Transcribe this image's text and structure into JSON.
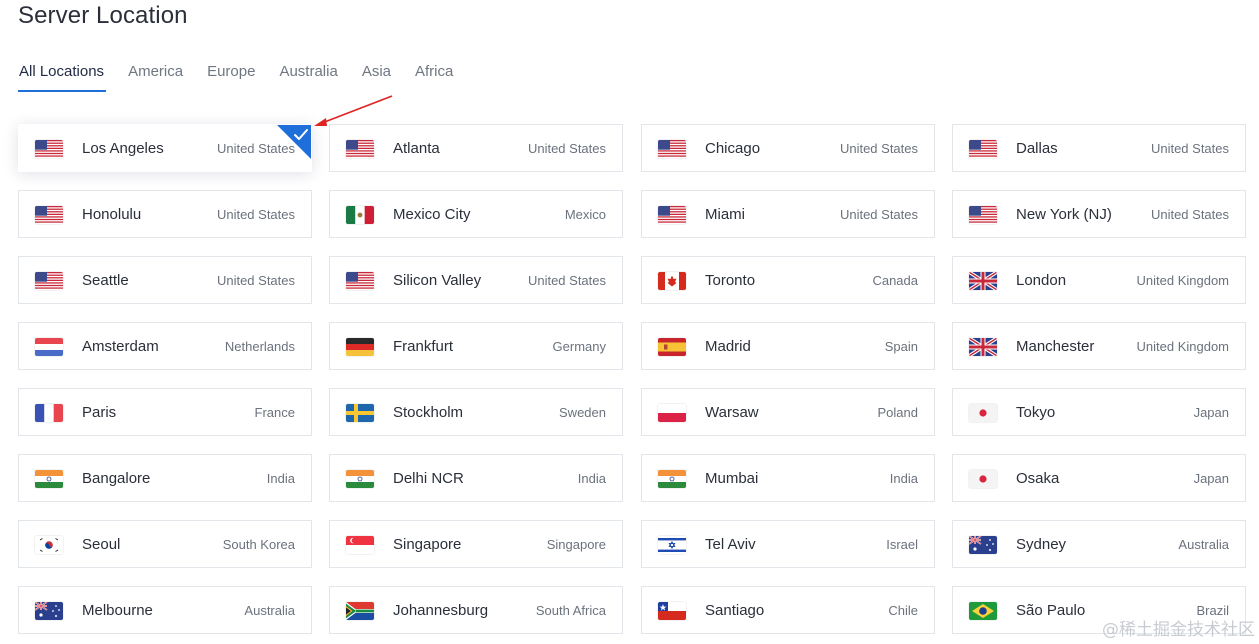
{
  "page_title": "Server Location",
  "tabs": [
    {
      "label": "All Locations",
      "active": true
    },
    {
      "label": "America",
      "active": false
    },
    {
      "label": "Europe",
      "active": false
    },
    {
      "label": "Australia",
      "active": false
    },
    {
      "label": "Asia",
      "active": false
    },
    {
      "label": "Africa",
      "active": false
    }
  ],
  "selected_location": "Los Angeles",
  "locations": [
    {
      "city": "Los Angeles",
      "country": "United States",
      "flag": "us-flag-icon",
      "selected": true
    },
    {
      "city": "Atlanta",
      "country": "United States",
      "flag": "us-flag-icon"
    },
    {
      "city": "Chicago",
      "country": "United States",
      "flag": "us-flag-icon"
    },
    {
      "city": "Dallas",
      "country": "United States",
      "flag": "us-flag-icon"
    },
    {
      "city": "Honolulu",
      "country": "United States",
      "flag": "us-flag-icon"
    },
    {
      "city": "Mexico City",
      "country": "Mexico",
      "flag": "mx-flag-icon"
    },
    {
      "city": "Miami",
      "country": "United States",
      "flag": "us-flag-icon"
    },
    {
      "city": "New York (NJ)",
      "country": "United States",
      "flag": "us-flag-icon"
    },
    {
      "city": "Seattle",
      "country": "United States",
      "flag": "us-flag-icon"
    },
    {
      "city": "Silicon Valley",
      "country": "United States",
      "flag": "us-flag-icon"
    },
    {
      "city": "Toronto",
      "country": "Canada",
      "flag": "ca-flag-icon"
    },
    {
      "city": "London",
      "country": "United Kingdom",
      "flag": "gb-flag-icon"
    },
    {
      "city": "Amsterdam",
      "country": "Netherlands",
      "flag": "nl-flag-icon"
    },
    {
      "city": "Frankfurt",
      "country": "Germany",
      "flag": "de-flag-icon"
    },
    {
      "city": "Madrid",
      "country": "Spain",
      "flag": "es-flag-icon"
    },
    {
      "city": "Manchester",
      "country": "United Kingdom",
      "flag": "gb-flag-icon"
    },
    {
      "city": "Paris",
      "country": "France",
      "flag": "fr-flag-icon"
    },
    {
      "city": "Stockholm",
      "country": "Sweden",
      "flag": "se-flag-icon"
    },
    {
      "city": "Warsaw",
      "country": "Poland",
      "flag": "pl-flag-icon"
    },
    {
      "city": "Tokyo",
      "country": "Japan",
      "flag": "jp-flag-icon"
    },
    {
      "city": "Bangalore",
      "country": "India",
      "flag": "in-flag-icon"
    },
    {
      "city": "Delhi NCR",
      "country": "India",
      "flag": "in-flag-icon"
    },
    {
      "city": "Mumbai",
      "country": "India",
      "flag": "in-flag-icon"
    },
    {
      "city": "Osaka",
      "country": "Japan",
      "flag": "jp-flag-icon"
    },
    {
      "city": "Seoul",
      "country": "South Korea",
      "flag": "kr-flag-icon"
    },
    {
      "city": "Singapore",
      "country": "Singapore",
      "flag": "sg-flag-icon"
    },
    {
      "city": "Tel Aviv",
      "country": "Israel",
      "flag": "il-flag-icon"
    },
    {
      "city": "Sydney",
      "country": "Australia",
      "flag": "au-flag-icon"
    },
    {
      "city": "Melbourne",
      "country": "Australia",
      "flag": "au-flag-icon"
    },
    {
      "city": "Johannesburg",
      "country": "South Africa",
      "flag": "za-flag-icon"
    },
    {
      "city": "Santiago",
      "country": "Chile",
      "flag": "cl-flag-icon"
    },
    {
      "city": "São Paulo",
      "country": "Brazil",
      "flag": "br-flag-icon"
    }
  ],
  "colors": {
    "accent": "#1e6fd9",
    "annotation_arrow": "#e02424"
  },
  "watermark": "@稀土掘金技术社区"
}
